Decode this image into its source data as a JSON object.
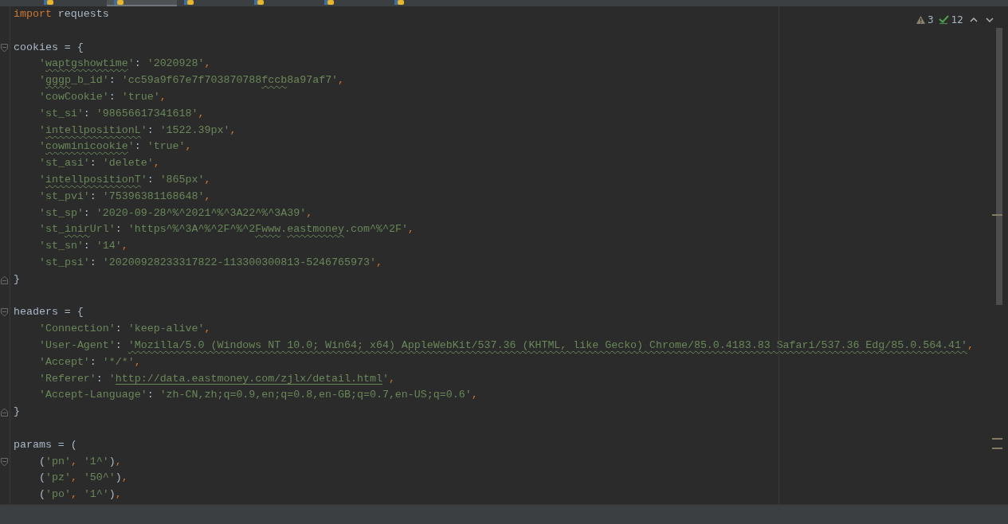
{
  "tabs": [
    {
      "selected": false
    },
    {
      "selected": true
    },
    {
      "selected": false
    },
    {
      "selected": false
    },
    {
      "selected": false
    },
    {
      "selected": false
    }
  ],
  "inspections": {
    "warnings": "3",
    "passed": "12"
  },
  "lines": [
    {
      "kind": "code",
      "indented": false,
      "tokens": [
        {
          "kind": "kw",
          "text": "import"
        },
        {
          "kind": "id",
          "text": " requests"
        }
      ]
    },
    {
      "kind": "blank"
    },
    {
      "kind": "code",
      "indented": false,
      "fold_start": true,
      "tokens": [
        {
          "kind": "id",
          "text": "cookies = {"
        }
      ]
    },
    {
      "kind": "code",
      "indented": true,
      "tokens": [
        {
          "kind": "s",
          "text": "'"
        },
        {
          "kind": "typo",
          "text": "waptgshowtime"
        },
        {
          "kind": "s",
          "text": "'"
        },
        {
          "kind": "id",
          "text": ": "
        },
        {
          "kind": "s",
          "text": "'2020928'"
        },
        {
          "kind": "c",
          "text": ","
        }
      ]
    },
    {
      "kind": "code",
      "indented": true,
      "tokens": [
        {
          "kind": "s",
          "text": "'"
        },
        {
          "kind": "typo",
          "text": "gggp"
        },
        {
          "kind": "s",
          "text": "_b_id'"
        },
        {
          "kind": "id",
          "text": ": "
        },
        {
          "kind": "s",
          "text": "'cc59a9f67e7f703870788"
        },
        {
          "kind": "typo",
          "text": "fccb"
        },
        {
          "kind": "s",
          "text": "8a97af7'"
        },
        {
          "kind": "c",
          "text": ","
        }
      ]
    },
    {
      "kind": "code",
      "indented": true,
      "tokens": [
        {
          "kind": "s",
          "text": "'cowCookie'"
        },
        {
          "kind": "id",
          "text": ": "
        },
        {
          "kind": "s",
          "text": "'true'"
        },
        {
          "kind": "c",
          "text": ","
        }
      ]
    },
    {
      "kind": "code",
      "indented": true,
      "tokens": [
        {
          "kind": "s",
          "text": "'st_si'"
        },
        {
          "kind": "id",
          "text": ": "
        },
        {
          "kind": "s",
          "text": "'98656617341618'"
        },
        {
          "kind": "c",
          "text": ","
        }
      ]
    },
    {
      "kind": "code",
      "indented": true,
      "tokens": [
        {
          "kind": "s",
          "text": "'"
        },
        {
          "kind": "typo",
          "text": "intellpositionL"
        },
        {
          "kind": "s",
          "text": "'"
        },
        {
          "kind": "id",
          "text": ": "
        },
        {
          "kind": "s",
          "text": "'1522.39px'"
        },
        {
          "kind": "c",
          "text": ","
        }
      ]
    },
    {
      "kind": "code",
      "indented": true,
      "tokens": [
        {
          "kind": "s",
          "text": "'"
        },
        {
          "kind": "typo",
          "text": "cowminicookie"
        },
        {
          "kind": "s",
          "text": "'"
        },
        {
          "kind": "id",
          "text": ": "
        },
        {
          "kind": "s",
          "text": "'true'"
        },
        {
          "kind": "c",
          "text": ","
        }
      ]
    },
    {
      "kind": "code",
      "indented": true,
      "tokens": [
        {
          "kind": "s",
          "text": "'st_asi'"
        },
        {
          "kind": "id",
          "text": ": "
        },
        {
          "kind": "s",
          "text": "'delete'"
        },
        {
          "kind": "c",
          "text": ","
        }
      ]
    },
    {
      "kind": "code",
      "indented": true,
      "tokens": [
        {
          "kind": "s",
          "text": "'"
        },
        {
          "kind": "typo",
          "text": "intellpositionT"
        },
        {
          "kind": "s",
          "text": "'"
        },
        {
          "kind": "id",
          "text": ": "
        },
        {
          "kind": "s",
          "text": "'865px'"
        },
        {
          "kind": "c",
          "text": ","
        }
      ]
    },
    {
      "kind": "code",
      "indented": true,
      "tokens": [
        {
          "kind": "s",
          "text": "'st_pvi'"
        },
        {
          "kind": "id",
          "text": ": "
        },
        {
          "kind": "s",
          "text": "'75396381168648'"
        },
        {
          "kind": "c",
          "text": ","
        }
      ]
    },
    {
      "kind": "code",
      "indented": true,
      "tokens": [
        {
          "kind": "s",
          "text": "'st_sp'"
        },
        {
          "kind": "id",
          "text": ": "
        },
        {
          "kind": "s",
          "text": "'2020-09-28^%^2021^%^3A22^%^3A39'"
        },
        {
          "kind": "c",
          "text": ","
        }
      ]
    },
    {
      "kind": "code",
      "indented": true,
      "tokens": [
        {
          "kind": "s",
          "text": "'st_"
        },
        {
          "kind": "typo",
          "text": "inir"
        },
        {
          "kind": "s",
          "text": "Url'"
        },
        {
          "kind": "id",
          "text": ": "
        },
        {
          "kind": "s",
          "text": "'https^%^3A^%^2F^%^2"
        },
        {
          "kind": "typo",
          "text": "Fwww"
        },
        {
          "kind": "s",
          "text": "."
        },
        {
          "kind": "typo",
          "text": "eastmoney"
        },
        {
          "kind": "s",
          "text": ".com^%^2F'"
        },
        {
          "kind": "c",
          "text": ","
        }
      ]
    },
    {
      "kind": "code",
      "indented": true,
      "tokens": [
        {
          "kind": "s",
          "text": "'st_sn'"
        },
        {
          "kind": "id",
          "text": ": "
        },
        {
          "kind": "s",
          "text": "'14'"
        },
        {
          "kind": "c",
          "text": ","
        }
      ]
    },
    {
      "kind": "code",
      "indented": true,
      "tokens": [
        {
          "kind": "s",
          "text": "'st_psi'"
        },
        {
          "kind": "id",
          "text": ": "
        },
        {
          "kind": "s",
          "text": "'20200928233317822-113300300813-5246765973'"
        },
        {
          "kind": "c",
          "text": ","
        }
      ]
    },
    {
      "kind": "code",
      "indented": false,
      "fold_end": true,
      "tokens": [
        {
          "kind": "id",
          "text": "}"
        }
      ]
    },
    {
      "kind": "blank"
    },
    {
      "kind": "code",
      "indented": false,
      "fold_start": true,
      "tokens": [
        {
          "kind": "id",
          "text": "headers = {"
        }
      ]
    },
    {
      "kind": "code",
      "indented": true,
      "tokens": [
        {
          "kind": "s",
          "text": "'Connection'"
        },
        {
          "kind": "id",
          "text": ": "
        },
        {
          "kind": "s",
          "text": "'keep-alive'"
        },
        {
          "kind": "c",
          "text": ","
        }
      ]
    },
    {
      "kind": "code",
      "indented": true,
      "tokens": [
        {
          "kind": "s",
          "text": "'User-Agent'"
        },
        {
          "kind": "id",
          "text": ": "
        },
        {
          "kind": "typo",
          "text": "'Mozilla/5.0 (Windows NT 10.0; Win64; x64) AppleWebKit/537.36 (KHTML, like Gecko) Chrome/85.0.4183.83 Safari/537.36 Edg/85.0.564.41'"
        },
        {
          "kind": "c",
          "text": ","
        }
      ]
    },
    {
      "kind": "code",
      "indented": true,
      "tokens": [
        {
          "kind": "s",
          "text": "'Accept'"
        },
        {
          "kind": "id",
          "text": ": "
        },
        {
          "kind": "s",
          "text": "'*/*'"
        },
        {
          "kind": "c",
          "text": ","
        }
      ]
    },
    {
      "kind": "code",
      "indented": true,
      "tokens": [
        {
          "kind": "s",
          "text": "'Referer'"
        },
        {
          "kind": "id",
          "text": ": "
        },
        {
          "kind": "s",
          "text": "'"
        },
        {
          "kind": "link",
          "text": "http://data.eastmoney.com/zjlx/detail.html"
        },
        {
          "kind": "s",
          "text": "'"
        },
        {
          "kind": "c",
          "text": ","
        }
      ]
    },
    {
      "kind": "code",
      "indented": true,
      "tokens": [
        {
          "kind": "s",
          "text": "'Accept-Language'"
        },
        {
          "kind": "id",
          "text": ": "
        },
        {
          "kind": "s",
          "text": "'zh-CN,zh;q=0.9,en;q=0.8,en-GB;q=0.7,en-US;q=0.6'"
        },
        {
          "kind": "c",
          "text": ","
        }
      ]
    },
    {
      "kind": "code",
      "indented": false,
      "fold_end": true,
      "tokens": [
        {
          "kind": "id",
          "text": "}"
        }
      ]
    },
    {
      "kind": "blank"
    },
    {
      "kind": "code",
      "indented": false,
      "tokens": [
        {
          "kind": "id",
          "text": "params = ("
        }
      ]
    },
    {
      "kind": "code",
      "indented": true,
      "fold_start": true,
      "tokens": [
        {
          "kind": "id",
          "text": "("
        },
        {
          "kind": "s",
          "text": "'pn'"
        },
        {
          "kind": "c",
          "text": ", "
        },
        {
          "kind": "s",
          "text": "'1^'"
        },
        {
          "kind": "id",
          "text": ")"
        },
        {
          "kind": "c",
          "text": ","
        }
      ]
    },
    {
      "kind": "code",
      "indented": true,
      "tokens": [
        {
          "kind": "id",
          "text": "("
        },
        {
          "kind": "s",
          "text": "'pz'"
        },
        {
          "kind": "c",
          "text": ", "
        },
        {
          "kind": "s",
          "text": "'50^'"
        },
        {
          "kind": "id",
          "text": ")"
        },
        {
          "kind": "c",
          "text": ","
        }
      ]
    },
    {
      "kind": "code",
      "indented": true,
      "tokens": [
        {
          "kind": "id",
          "text": "("
        },
        {
          "kind": "s",
          "text": "'po'"
        },
        {
          "kind": "c",
          "text": ", "
        },
        {
          "kind": "s",
          "text": "'1^'"
        },
        {
          "kind": "id",
          "text": ")"
        },
        {
          "kind": "c",
          "text": ","
        }
      ]
    }
  ]
}
